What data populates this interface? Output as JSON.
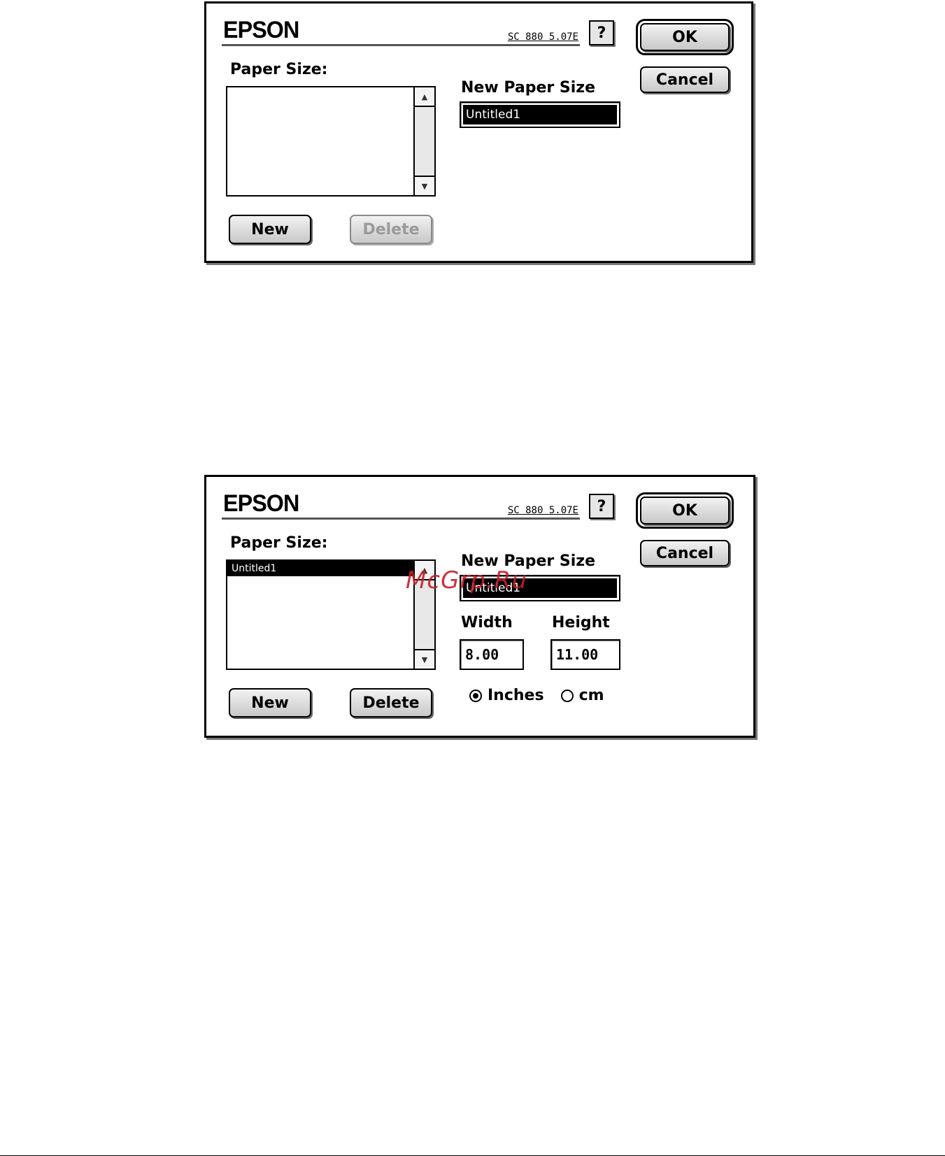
{
  "dialog_before": {
    "brand": "EPSON",
    "model": "SC 880 5.07E",
    "help_label": "?",
    "ok_label": "OK",
    "cancel_label": "Cancel",
    "paper_size_label": "Paper Size:",
    "paper_size_items": [],
    "new_paper_size_label": "New Paper Size",
    "new_paper_size_value": "Untitled1",
    "new_label": "New",
    "delete_label": "Delete"
  },
  "dialog_after": {
    "brand": "EPSON",
    "model": "SC 880 5.07E",
    "help_label": "?",
    "ok_label": "OK",
    "cancel_label": "Cancel",
    "paper_size_label": "Paper Size:",
    "paper_size_items": [
      "Untitled1"
    ],
    "new_paper_size_label": "New Paper Size",
    "new_paper_size_value": "Untitled1",
    "width_label": "Width",
    "width_value": "8.00",
    "height_label": "Height",
    "height_value": "11.00",
    "units": {
      "inches_label": "Inches",
      "cm_label": "cm",
      "selected": "Inches"
    },
    "new_label": "New",
    "delete_label": "Delete"
  },
  "watermark": "McGrp.Ru"
}
